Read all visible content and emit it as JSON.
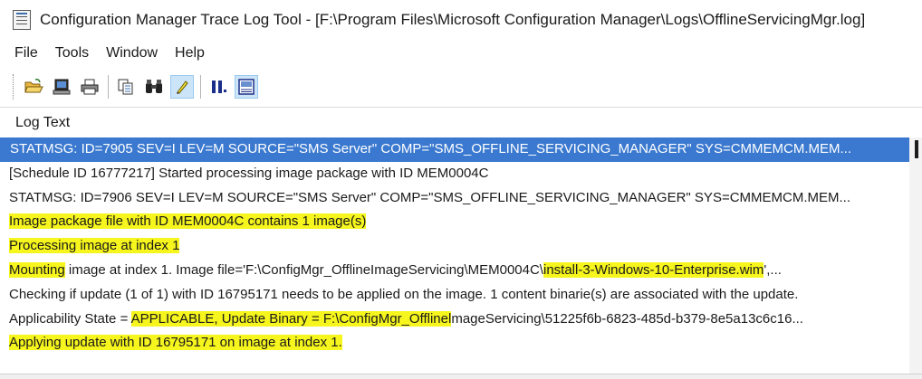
{
  "window": {
    "title": "Configuration Manager Trace Log Tool - [F:\\Program Files\\Microsoft Configuration Manager\\Logs\\OfflineServicingMgr.log]"
  },
  "menu": [
    "File",
    "Tools",
    "Window",
    "Help"
  ],
  "toolbar": {
    "buttons": [
      "open-folder-icon",
      "server-icon",
      "printer-icon",
      "copy-icon",
      "find-icon",
      "highlight-icon",
      "pause-icon",
      "error-lookup-icon"
    ]
  },
  "log": {
    "column_header": "Log Text",
    "rows": [
      {
        "text": "STATMSG: ID=7905 SEV=I LEV=M SOURCE=\"SMS Server\" COMP=\"SMS_OFFLINE_SERVICING_MANAGER\" SYS=CMMEMCM.MEM..."
      },
      {
        "text": "[Schedule ID 16777217] Started processing image package with ID MEM0004C"
      },
      {
        "text": "STATMSG: ID=7906 SEV=I LEV=M SOURCE=\"SMS Server\" COMP=\"SMS_OFFLINE_SERVICING_MANAGER\" SYS=CMMEMCM.MEM..."
      },
      {
        "text": "Image package file with ID MEM0004C contains 1 image(s)"
      },
      {
        "text": "Processing image at index 1"
      },
      {
        "text_part1": "Mounting",
        "text_part2": " image at index 1. Image file='F:\\ConfigMgr_OfflineImageServicing\\MEM0004C\\",
        "text_part3": "install-3-Windows-10-Enterprise.wim",
        "text_part4": "',..."
      },
      {
        "text": "Checking if update (1 of 1) with ID 16795171 needs to be applied on the image. 1 content binarie(s) are associated with the update."
      },
      {
        "text_part1": "Applicability State = ",
        "text_part2": " APPLICABLE, Update Binary = F:\\ConfigMgr_Offlinel",
        "text_part3": "mageServicing\\51225f6b-6823-485d-b379-8e5a13c6c16..."
      },
      {
        "text": "Applying update with ID 16795171 on image at index 1."
      }
    ]
  },
  "colors": {
    "selection": "#3a79cf",
    "highlight": "#f6f51d"
  }
}
